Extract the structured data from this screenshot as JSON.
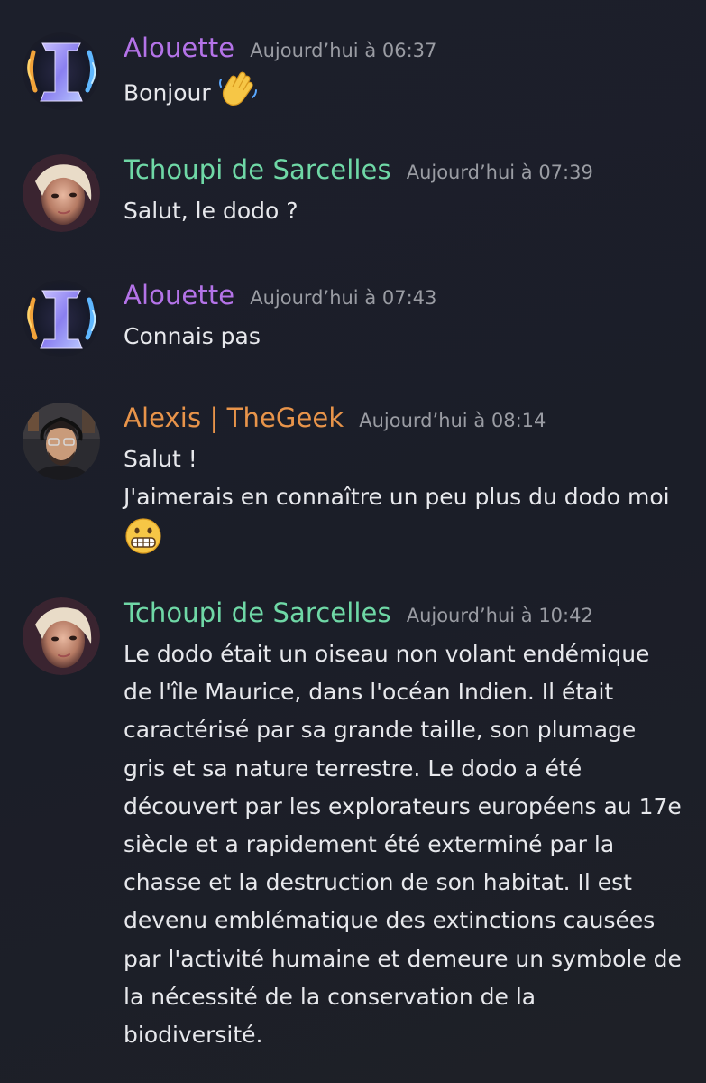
{
  "colors": {
    "background": "#1c1f2b",
    "alouette": "#b473e8",
    "tchoupi": "#6fd8a6",
    "alexis": "#e8944a",
    "timestamp": "#9a9ca3",
    "text": "#e7e8ec"
  },
  "messages": [
    {
      "author": "Alouette",
      "timestamp": "Aujourd’hui à 06:37",
      "lines": [
        "Bonjour"
      ],
      "emoji": "waving-hand-icon"
    },
    {
      "author": "Tchoupi de Sarcelles",
      "timestamp": "Aujourd’hui à 07:39",
      "lines": [
        "Salut, le dodo ?"
      ]
    },
    {
      "author": "Alouette",
      "timestamp": "Aujourd’hui à 07:43",
      "lines": [
        "Connais pas"
      ]
    },
    {
      "author": "Alexis | TheGeek",
      "timestamp": "Aujourd’hui à 08:14",
      "lines": [
        "Salut !",
        "J'aimerais en connaître un peu plus du dodo moi"
      ],
      "emoji": "grimacing-face-icon"
    },
    {
      "author": "Tchoupi de Sarcelles",
      "timestamp": "Aujourd’hui à 10:42",
      "lines": [
        "Le dodo était un oiseau non volant endémique",
        "de l'île Maurice, dans l'océan Indien. Il était",
        "caractérisé par sa grande taille, son plumage",
        "gris et sa nature terrestre. Le dodo a été",
        "découvert par les explorateurs européens au 17e",
        "siècle et a rapidement été exterminé par la",
        "chasse et la destruction de son habitat. Il est",
        "devenu emblématique des extinctions causées",
        "par l'activité humaine et demeure un symbole de",
        "la nécessité de la conservation de la",
        "biodiversité."
      ]
    }
  ]
}
